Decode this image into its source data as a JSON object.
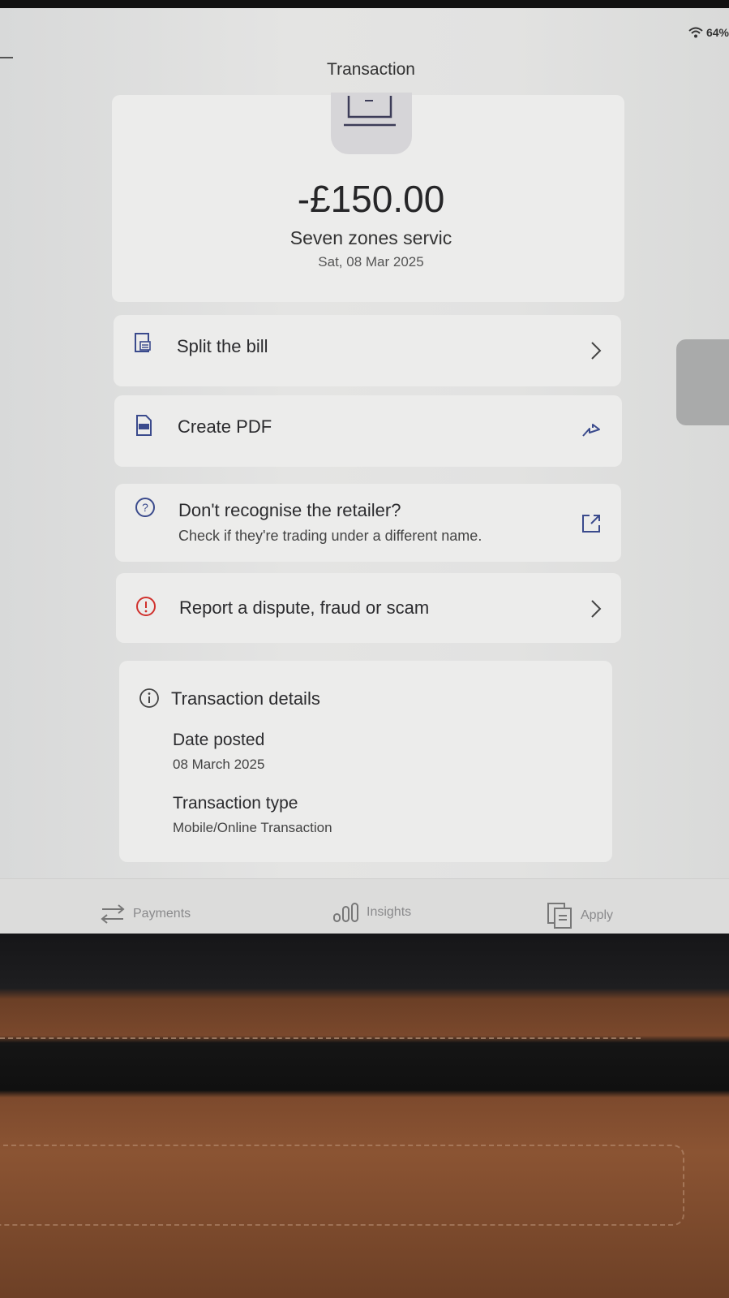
{
  "status": {
    "battery": "64%"
  },
  "header": {
    "title": "Transaction"
  },
  "transaction": {
    "amount": "-£150.00",
    "merchant": "Seven zones servic",
    "date": "Sat, 08 Mar 2025"
  },
  "actions": [
    {
      "label": "Split the bill"
    },
    {
      "label": "Create PDF"
    },
    {
      "label": "Don't recognise the retailer?",
      "sublabel": "Check if they're trading under a different name."
    },
    {
      "label": "Report a dispute, fraud or scam"
    }
  ],
  "details": {
    "title": "Transaction details",
    "date_posted_label": "Date posted",
    "date_posted_value": "08 March 2025",
    "type_label": "Transaction type",
    "type_value": "Mobile/Online Transaction"
  },
  "tabs": [
    {
      "label": "Payments"
    },
    {
      "label": "Insights"
    },
    {
      "label": "Apply"
    }
  ],
  "colors": {
    "alert": "#d0312d",
    "icon_blue": "#3a4a8c"
  }
}
